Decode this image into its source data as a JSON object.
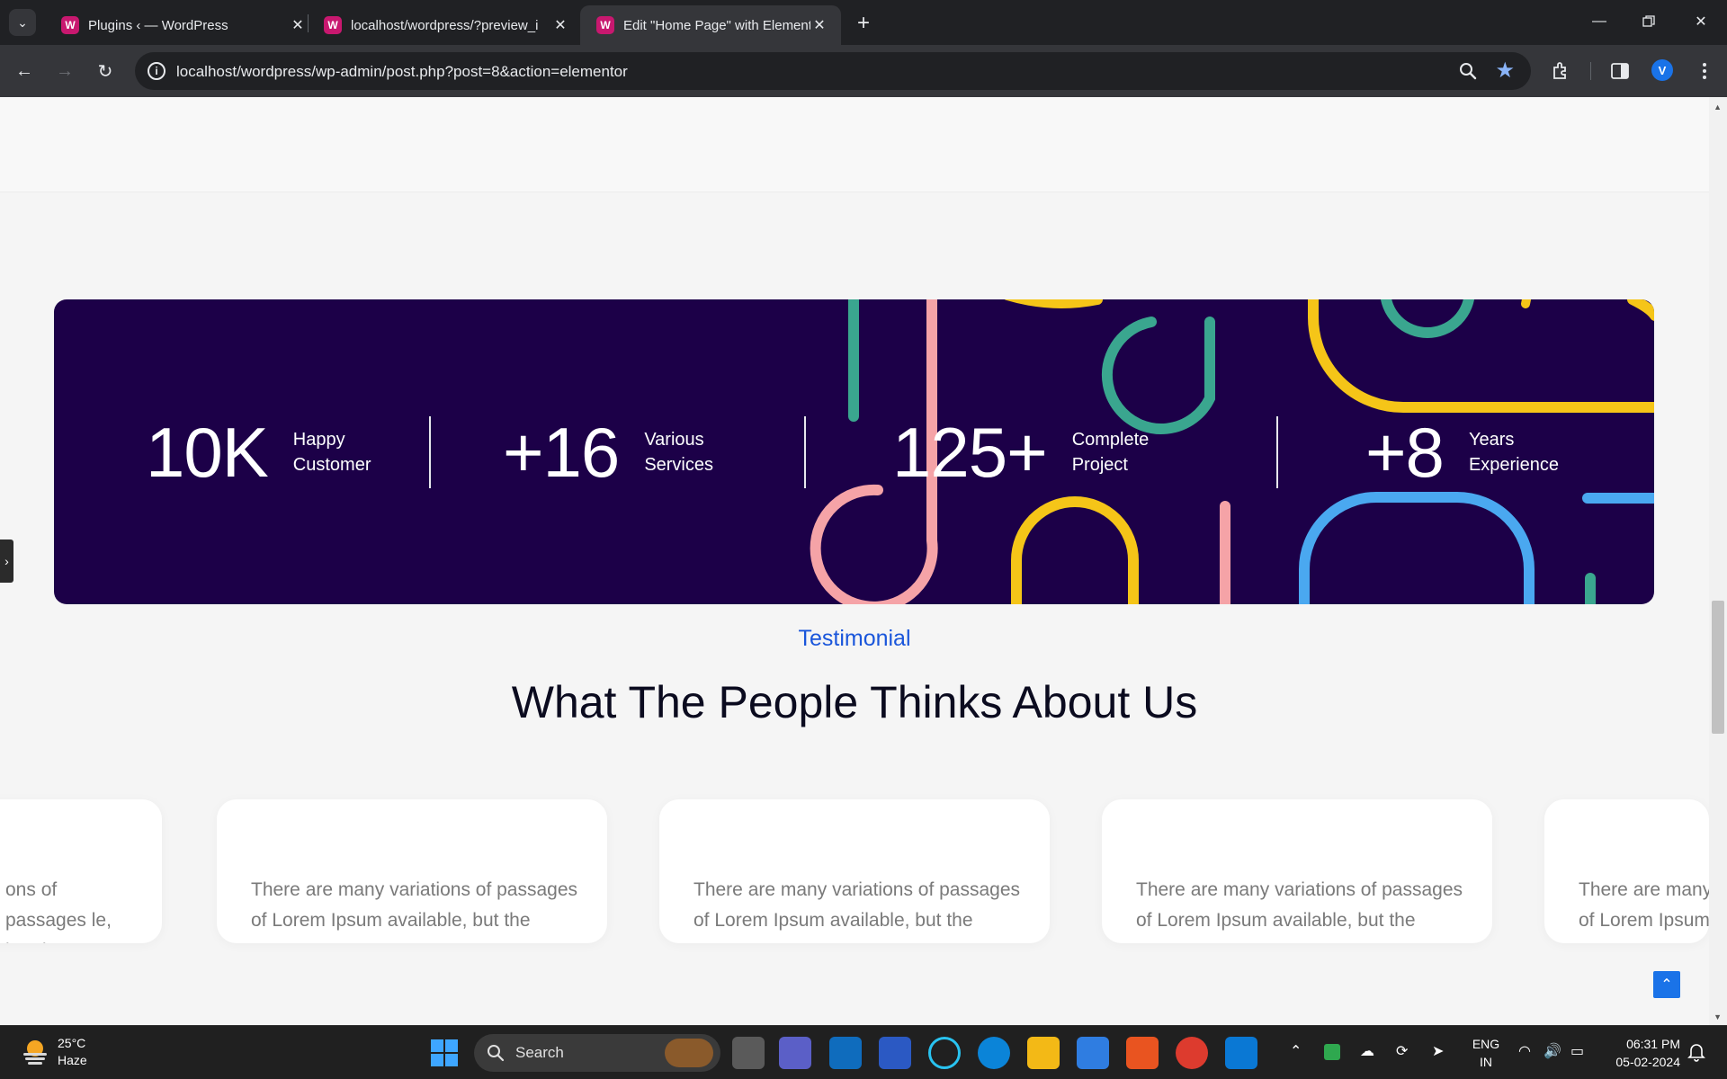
{
  "browser": {
    "tabs": [
      {
        "title": "Plugins ‹ — WordPress",
        "favicon": "wp-local-icon",
        "active": false
      },
      {
        "title": "localhost/wordpress/?preview_i",
        "favicon": "wp-local-icon",
        "active": false
      },
      {
        "title": "Edit \"Home Page\" with Element",
        "favicon": "wp-local-icon",
        "active": true
      }
    ],
    "url": "localhost/wordpress/wp-admin/post.php?post=8&action=elementor",
    "profile_initial": "V"
  },
  "stats": [
    {
      "value": "10K",
      "label_line1": "Happy",
      "label_line2": "Customer"
    },
    {
      "value": "+16",
      "label_line1": "Various",
      "label_line2": "Services"
    },
    {
      "value": "125+",
      "label_line1": "Complete",
      "label_line2": "Project"
    },
    {
      "value": "+8",
      "label_line1": "Years",
      "label_line2": "Experience"
    }
  ],
  "testimonial": {
    "eyebrow": "Testimonial",
    "title": "What The People Thinks About Us",
    "cards": [
      {
        "text": "ons of passages le, but the"
      },
      {
        "text": "There are many variations of passages of Lorem Ipsum available, but the"
      },
      {
        "text": "There are many variations of passages of Lorem Ipsum available, but the"
      },
      {
        "text": "There are many variations of passages of Lorem Ipsum available, but the"
      },
      {
        "text": "There are many of Lorem Ipsum"
      }
    ]
  },
  "taskbar": {
    "weather_temp": "25°C",
    "weather_desc": "Haze",
    "search_label": "Search",
    "lang_line1": "ENG",
    "lang_line2": "IN",
    "time": "06:31 PM",
    "date": "05-02-2024"
  },
  "colors": {
    "banner_bg": "#1c0048",
    "accent_blue": "#1a56db",
    "art_teal": "#3aa68f",
    "art_pink": "#f5a3a7",
    "art_yellow": "#f5c518",
    "art_blue": "#4aa8f0"
  }
}
